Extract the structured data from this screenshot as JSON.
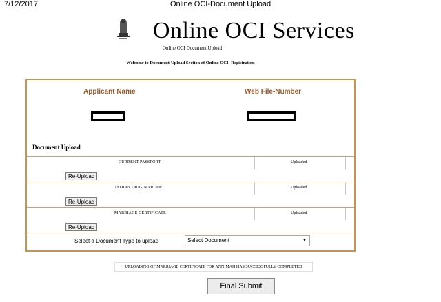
{
  "print_header": {
    "date": "7/12/2017",
    "title": "Online OCI-Document Upload"
  },
  "brand": {
    "title": "Online OCI Services",
    "subtitle": "Online OCI Document Upload",
    "welcome": "Welcome to Document-Upload Section of Online OCI- Registration"
  },
  "applicant": {
    "name_label": "Applicant Name",
    "webfile_label": "Web File-Number"
  },
  "documents": {
    "heading": "Document Upload",
    "rows": [
      {
        "name": "CURRENT PASSPORT",
        "status": "Uploaded",
        "button": "Re-Upload"
      },
      {
        "name": "INDIAN ORIGIN PROOF",
        "status": "Uploaded",
        "button": "Re-Upload"
      },
      {
        "name": "MARRIAGE CERTIFICATE",
        "status": "Uploaded",
        "button": "Re-Upload"
      }
    ]
  },
  "select": {
    "label": "Select a Document Type to upload",
    "value": "Select Document"
  },
  "message": "UPLOADING OF MARRIAGE CERTIFICATE FOR ANNIMAH HAS SUCCESSFULLY COMPLETED",
  "final_button": "Final Submit",
  "colors": {
    "panel_border": "#c8934b",
    "label_brown": "#9b5a2a"
  },
  "icons": {
    "emblem": "national-emblem-icon",
    "dropdown": "chevron-down-icon"
  }
}
